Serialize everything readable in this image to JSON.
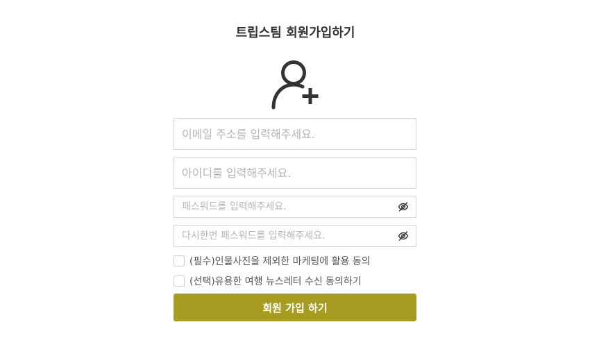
{
  "page": {
    "title": "트립스팀 회원가입하기"
  },
  "icons": {
    "avatar": "user-plus-icon",
    "password_toggle": "eye-slash-icon"
  },
  "form": {
    "email": {
      "placeholder": "이메일 주소를 입력해주세요.",
      "value": ""
    },
    "user_id": {
      "placeholder": "아이디를 입력해주세요.",
      "value": ""
    },
    "password": {
      "placeholder": "패스워드를 입력해주세요.",
      "value": ""
    },
    "password_confirm": {
      "placeholder": "다시한번 패스워드를 입력해주세요.",
      "value": ""
    },
    "agree_required_label": "(필수)인물사진을 제외한 마케팅에 활용 동의",
    "agree_optional_label": "(선택)유용한 여행 뉴스레터 수신 동의하기",
    "submit_label": "회원 가입 하기"
  },
  "colors": {
    "accent": "#a89b22",
    "text": "#333333",
    "placeholder": "#b4b4b4",
    "border": "#d6d6d6"
  }
}
